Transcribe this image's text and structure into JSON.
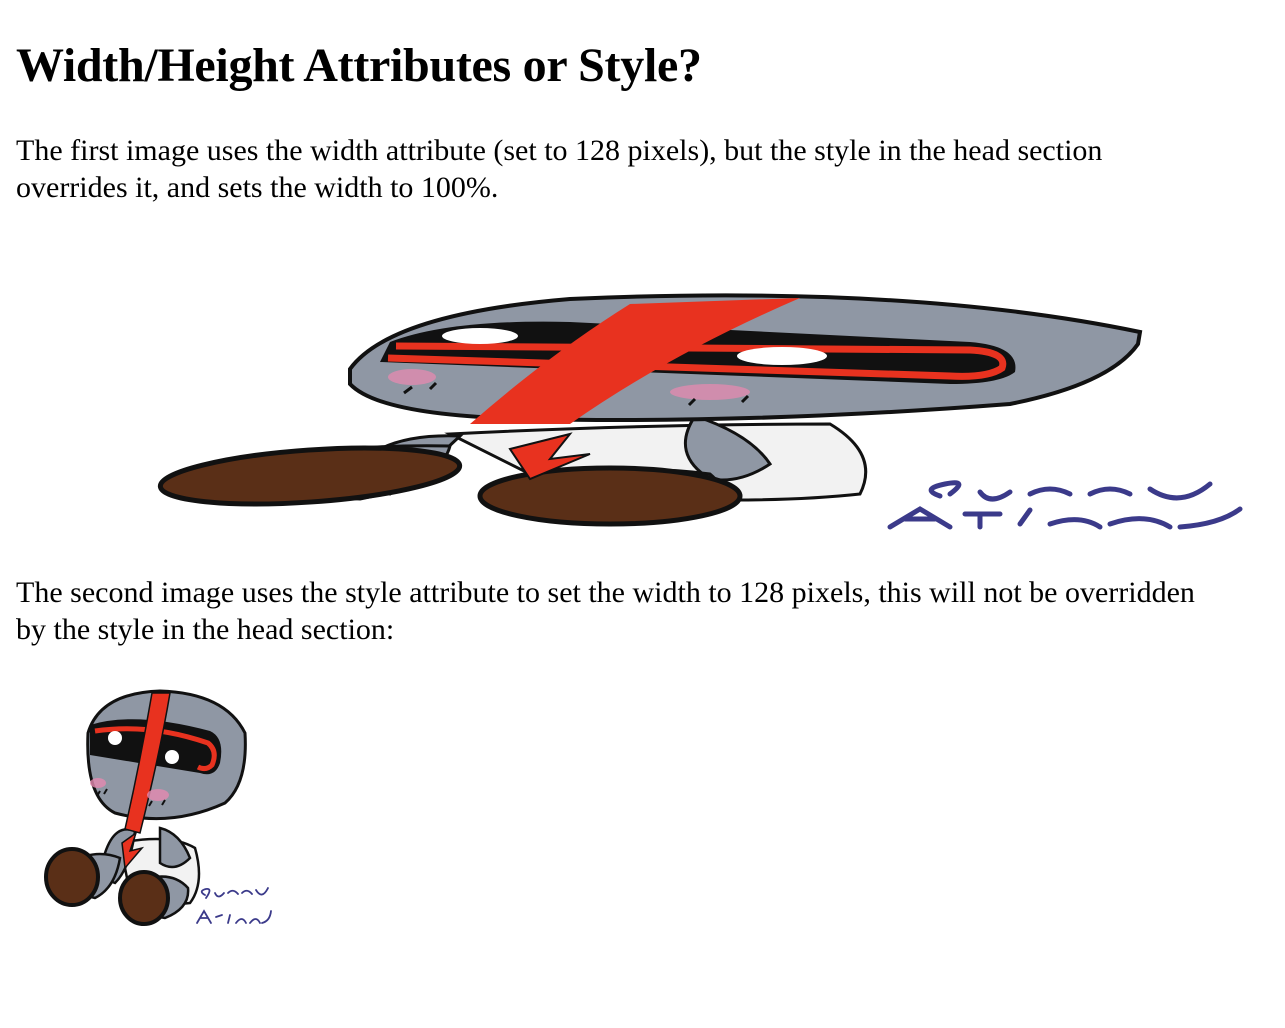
{
  "page": {
    "heading": "Width/Height Attributes or Style?",
    "paragraph1": "The first image uses the width attribute (set to 128 pixels), but the style in the head section overrides it, and sets the width to 100%.",
    "paragraph2": "The second image uses the style attribute to set the width to 128 pixels, this will not be overridden by the style in the head section:"
  },
  "images": {
    "stretched": {
      "description_icon": "robot-character-image",
      "signature": [
        "Sunny",
        "Arissd"
      ]
    },
    "normal": {
      "description_icon": "robot-character-image",
      "signature": [
        "Sunny",
        "Arissd"
      ]
    }
  },
  "colors": {
    "body_gray": "#8f97a4",
    "stripe_red": "#e8321f",
    "visor_black": "#111111",
    "feet_brown": "#5a2f17",
    "blush_pink": "#e58ab0",
    "signature_ink": "#3b3a8a"
  }
}
